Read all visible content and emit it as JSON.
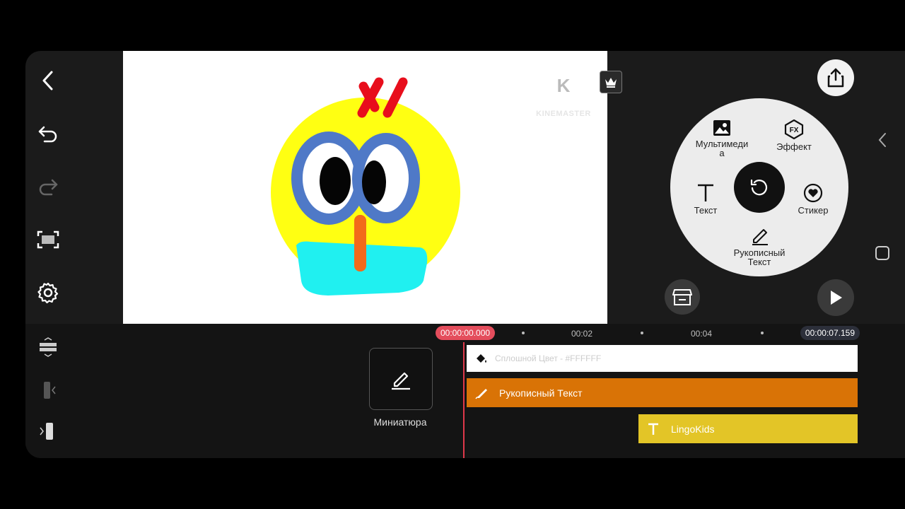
{
  "preview": {
    "watermark": "KINEMASTER"
  },
  "wheel": {
    "media_label": "Мультимеди\nа",
    "effect_label": "Эффект",
    "text_label": "Текст",
    "sticker_label": "Стикер",
    "handwriting_label": "Рукописный\nТекст"
  },
  "timeline": {
    "current_time": "00:00:00.000",
    "tick_2": "00:02",
    "tick_4": "00:04",
    "end_time": "00:00:07.159",
    "thumbnail_label": "Миниатюра",
    "clips": {
      "solid_color": "Сплошной Цвет - #FFFFFF",
      "handwriting": "Рукописный Текст",
      "text_layer": "LingoKids"
    }
  },
  "colors": {
    "playhead": "#e0384a",
    "handwriting_clip": "#d97306",
    "text_clip": "#e3c527",
    "solid_clip": "#ffffff"
  }
}
